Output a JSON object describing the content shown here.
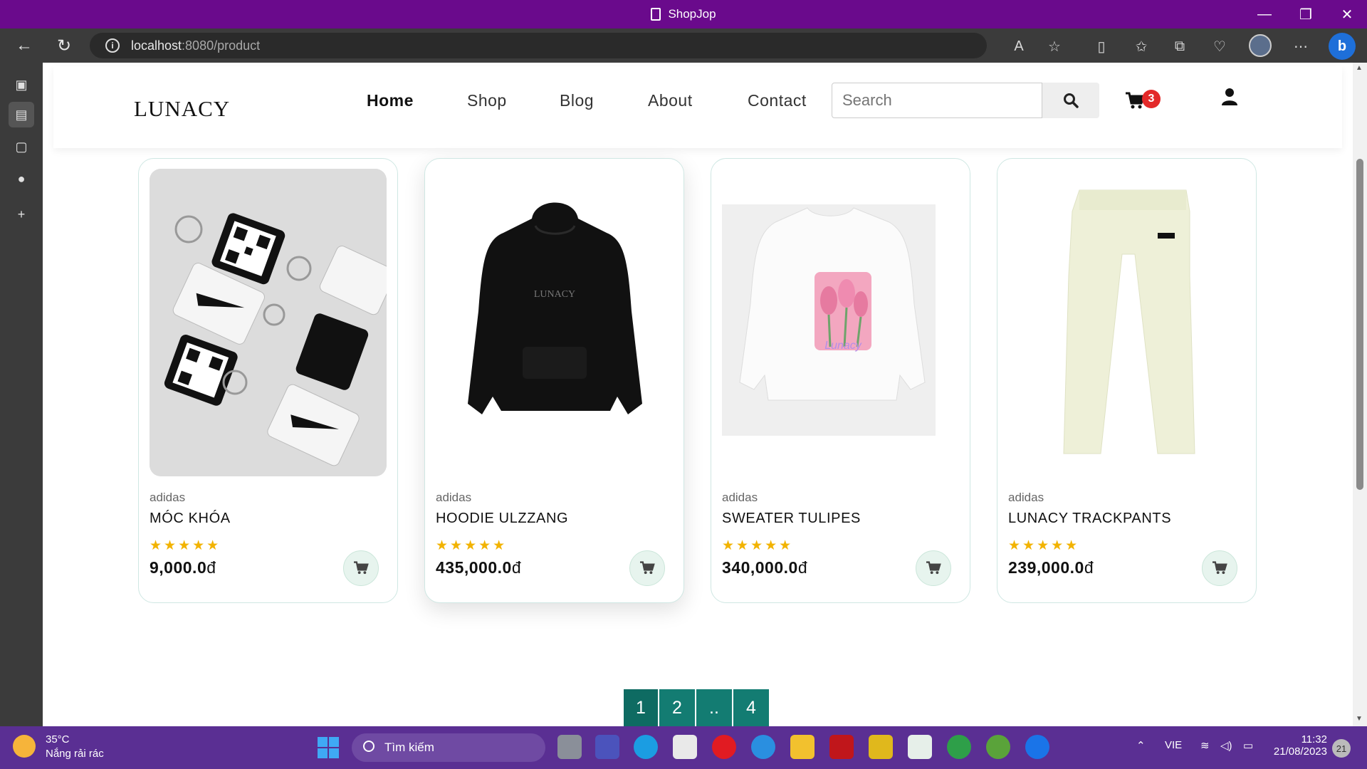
{
  "window": {
    "title": "ShopJop"
  },
  "browser": {
    "url_host": "localhost",
    "url_path": ":8080/product"
  },
  "site": {
    "logo": "LUNACY",
    "menu": [
      "Home",
      "Shop",
      "Blog",
      "About",
      "Contact"
    ],
    "search_placeholder": "Search",
    "cart_count": "3"
  },
  "products": [
    {
      "brand": "adidas",
      "name": "MÓC KHÓA",
      "stars": "★★★★★",
      "price": "9,000.0",
      "currency": "đ"
    },
    {
      "brand": "adidas",
      "name": "HOODIE ULZZANG",
      "stars": "★★★★★",
      "price": "435,000.0",
      "currency": "đ"
    },
    {
      "brand": "adidas",
      "name": "SWEATER TULIPES",
      "stars": "★★★★★",
      "price": "340,000.0",
      "currency": "đ"
    },
    {
      "brand": "adidas",
      "name": "LUNACY TRACKPANTS",
      "stars": "★★★★★",
      "price": "239,000.0",
      "currency": "đ"
    }
  ],
  "pagination": [
    "1",
    "2",
    "..",
    "4"
  ],
  "taskbar": {
    "temp": "35°C",
    "weather": "Nắng rải rác",
    "search_label": "Tìm kiếm",
    "lang": "VIE",
    "time": "11:32",
    "date": "21/08/2023",
    "notifications": "21"
  },
  "colors": {
    "titlebar": "#6a0a8c",
    "taskbar": "#5a2f93",
    "accent": "#137c72",
    "badge": "#e32929",
    "stars": "#f2b300"
  }
}
